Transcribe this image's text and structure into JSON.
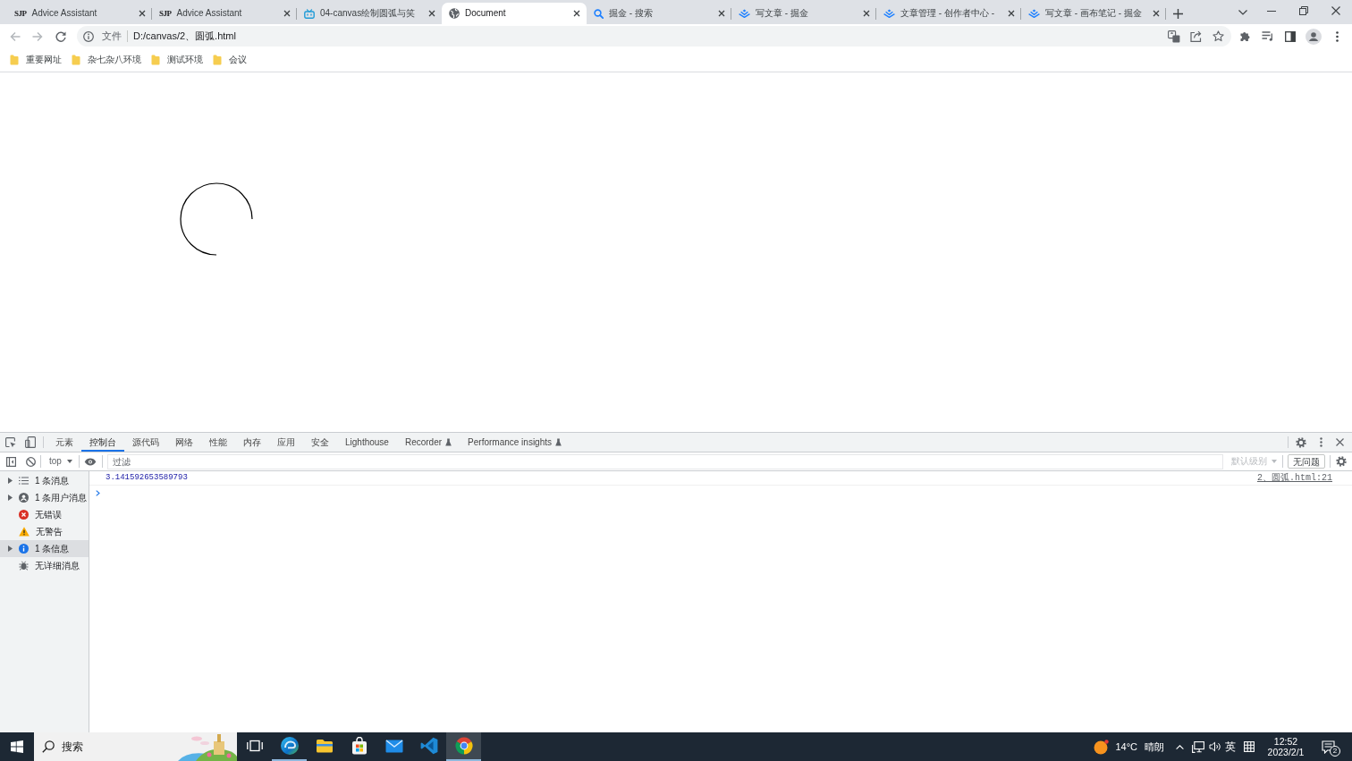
{
  "browser": {
    "tabs": [
      {
        "kind": "monogram",
        "favicon_text": "SJP",
        "title": "Advice Assistant",
        "selected": false
      },
      {
        "kind": "monogram",
        "favicon_text": "SJP",
        "title": "Advice Assistant",
        "selected": false
      },
      {
        "kind": "tv",
        "title": "04-canvas绘制圆弧与笑",
        "selected": false
      },
      {
        "kind": "globe",
        "title": "Document",
        "selected": true
      },
      {
        "kind": "search",
        "title": "掘金 - 搜索",
        "selected": false
      },
      {
        "kind": "layers",
        "title": "写文章 - 掘金",
        "selected": false
      },
      {
        "kind": "layers",
        "title": "文章管理 - 创作者中心 -",
        "selected": false
      },
      {
        "kind": "layers",
        "title": "写文章 - 画布笔记 - 掘金",
        "selected": false
      }
    ],
    "navigation": {
      "back_disabled": true,
      "forward_disabled": true
    },
    "address_bar": {
      "security_label": "文件",
      "url": "D:/canvas/2、圆弧.html"
    },
    "bookmarks": [
      "重要网址",
      "杂七杂八环境",
      "测试环境",
      "会议"
    ]
  },
  "devtools": {
    "tabs": [
      {
        "label": "元素",
        "selected": false,
        "experimental": false
      },
      {
        "label": "控制台",
        "selected": true,
        "experimental": false
      },
      {
        "label": "源代码",
        "selected": false,
        "experimental": false
      },
      {
        "label": "网络",
        "selected": false,
        "experimental": false
      },
      {
        "label": "性能",
        "selected": false,
        "experimental": false
      },
      {
        "label": "内存",
        "selected": false,
        "experimental": false
      },
      {
        "label": "应用",
        "selected": false,
        "experimental": false
      },
      {
        "label": "安全",
        "selected": false,
        "experimental": false
      },
      {
        "label": "Lighthouse",
        "selected": false,
        "experimental": false
      },
      {
        "label": "Recorder",
        "selected": false,
        "experimental": true
      },
      {
        "label": "Performance insights",
        "selected": false,
        "experimental": true
      }
    ],
    "console_toolbar": {
      "context": "top",
      "filter_placeholder": "过滤",
      "levels": {
        "label": "默认级别",
        "disabled": true
      },
      "issues": "无问题"
    },
    "sidebar": [
      {
        "kind": "messages",
        "label": "1 条消息",
        "expandable": true,
        "selected": false
      },
      {
        "kind": "user",
        "label": "1 条用户消息",
        "expandable": true,
        "selected": false
      },
      {
        "kind": "error",
        "label": "无错误",
        "expandable": false,
        "selected": false
      },
      {
        "kind": "warning",
        "label": "无警告",
        "expandable": false,
        "selected": false
      },
      {
        "kind": "info",
        "label": "1 条信息",
        "expandable": true,
        "selected": true
      },
      {
        "kind": "verbose",
        "label": "无详细消息",
        "expandable": false,
        "selected": false
      }
    ],
    "messages": [
      {
        "text": "3.141592653589793",
        "source": "2、圆弧.html:21"
      }
    ]
  },
  "taskbar": {
    "search_placeholder": "搜索",
    "apps": [
      {
        "kind": "taskview",
        "running": false,
        "selected": false
      },
      {
        "kind": "swirl",
        "running": true,
        "selected": false
      },
      {
        "kind": "folder",
        "running": false,
        "selected": false
      },
      {
        "kind": "bag",
        "running": false,
        "selected": false
      },
      {
        "kind": "mail",
        "running": false,
        "selected": false
      },
      {
        "kind": "code",
        "running": false,
        "selected": false
      },
      {
        "kind": "browser",
        "running": true,
        "selected": true
      }
    ],
    "weather": {
      "temperature": "14°C",
      "condition": "晴朗"
    },
    "input_language": "英",
    "clock": {
      "time": "12:52",
      "date": "2023/2/1"
    },
    "notification_count": "2"
  }
}
